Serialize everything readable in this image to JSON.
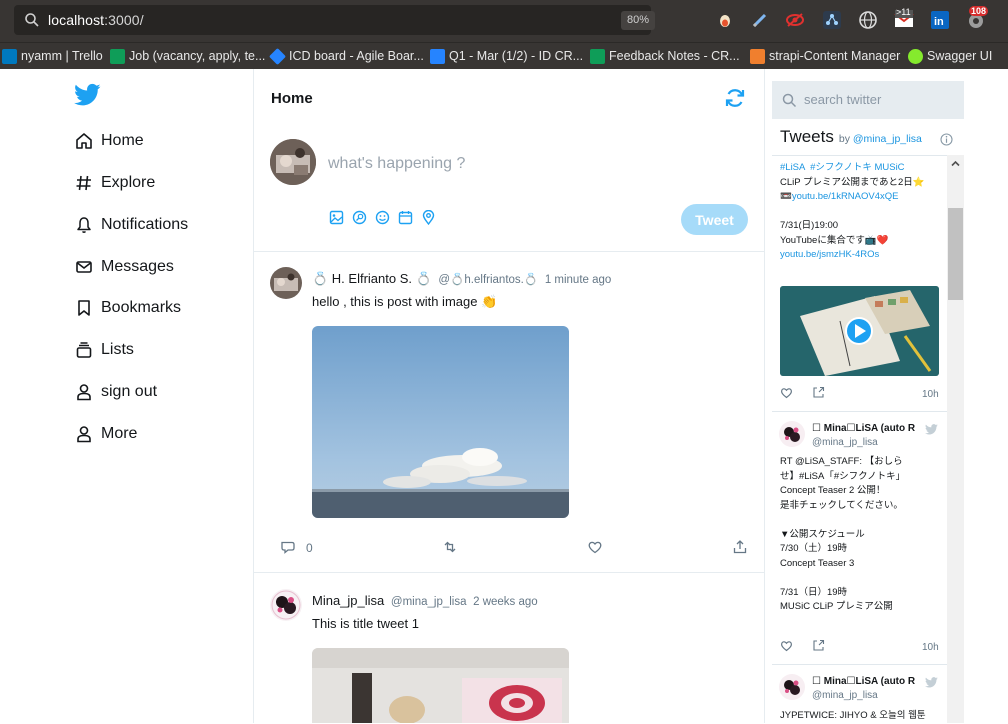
{
  "browser": {
    "url_host": "localhost",
    "url_rest": ":3000/",
    "zoom": "80%",
    "ext_badge_11": ">11",
    "ext_badge_108": "108",
    "bookmarks": [
      {
        "label": "nyamm | Trello",
        "color": "#0079bf"
      },
      {
        "label": "Job (vacancy, apply, te...",
        "color": "#0f9d58"
      },
      {
        "label": "ICD board - Agile Boar...",
        "color": "#2684ff"
      },
      {
        "label": "Q1 - Mar (1/2) - ID CR...",
        "color": "#2684ff"
      },
      {
        "label": "Feedback Notes - CR...",
        "color": "#0f9d58"
      },
      {
        "label": "strapi-Content Manager",
        "color": "#f07f2e"
      },
      {
        "label": "Swagger UI",
        "color": "#85ea2d"
      }
    ]
  },
  "nav": {
    "items": [
      {
        "label": "Home",
        "icon": "home-icon"
      },
      {
        "label": "Explore",
        "icon": "hash-icon"
      },
      {
        "label": "Notifications",
        "icon": "bell-icon"
      },
      {
        "label": "Messages",
        "icon": "mail-icon"
      },
      {
        "label": "Bookmarks",
        "icon": "bookmark-icon"
      },
      {
        "label": "Lists",
        "icon": "list-icon"
      },
      {
        "label": "sign out",
        "icon": "user-icon"
      },
      {
        "label": "More",
        "icon": "user-icon"
      }
    ]
  },
  "main": {
    "title": "Home",
    "composer_placeholder": "what's happening ?",
    "tweet_button": "Tweet",
    "posts": [
      {
        "name": "💍 H. Elfrianto S. 💍",
        "handle": "@💍h.elfriantos.💍",
        "time": "1 minute ago",
        "text": "hello , this is post with image 👏",
        "reply_count": "0"
      },
      {
        "name": "Mina_jp_lisa",
        "handle": "@mina_jp_lisa",
        "time": "2 weeks ago",
        "text": "This is title tweet 1"
      }
    ]
  },
  "sidebar": {
    "search_placeholder": "search twitter",
    "timeline_title": "Tweets",
    "timeline_by": "by",
    "timeline_user": "@mina_jp_lisa",
    "tweet1": {
      "lines": [
        "#LiSA  #シフクノトキ MUSiC",
        "CLiP プレミア公開まであと2日⭐",
        "📼youtu.be/1kRNAOV4xQE",
        "",
        "7/31(日)19:00",
        "YouTubeに集合です📺❤️",
        "youtu.be/jsmzHK-4ROs"
      ],
      "time": "10h"
    },
    "tweet2": {
      "name": "☐ Mina☐LiSA (auto R",
      "handle": "@mina_jp_lisa",
      "lines": [
        "RT @LiSA_STAFF: 【おしら",
        "せ】#LiSA「#シフクノトキ」",
        "Concept Teaser 2 公開！",
        "是非チェックしてください。",
        "",
        "▼公開スケジュール",
        "7/30（土）19時",
        "Concept Teaser 3",
        "",
        "7/31（日）19時",
        "MUSiC CLiP プレミア公開"
      ],
      "time": "10h"
    },
    "tweet3": {
      "name": "☐ Mina☐LiSA (auto R",
      "handle": "@mina_jp_lisa",
      "lines": [
        "JYPETWICE: JIHYO & 오늘의 웹툰"
      ]
    }
  },
  "colors": {
    "twitter_blue": "#1da1f2",
    "tweet_button_disabled": "#a6dbf9",
    "link": "#1b95e0",
    "chrome_bg": "#383533"
  }
}
